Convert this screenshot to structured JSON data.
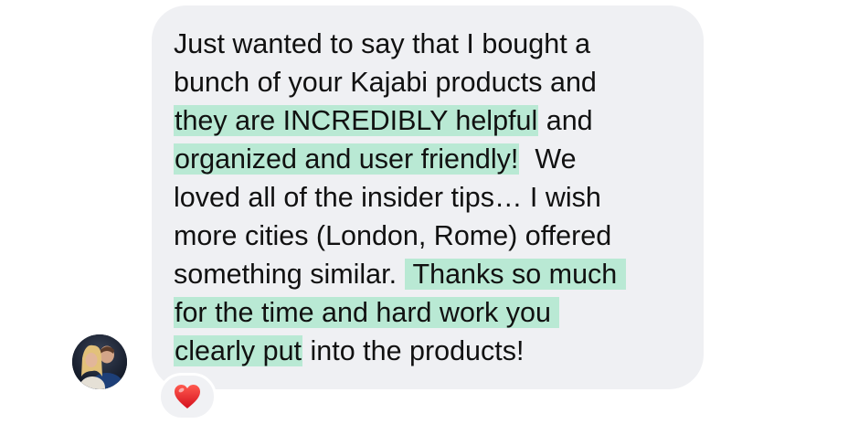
{
  "message": {
    "lines": [
      {
        "before": "Just wanted to say that I bought a",
        "highlight": "",
        "after": ""
      },
      {
        "before": "bunch of your Kajabi products and",
        "highlight": "",
        "after": ""
      },
      {
        "before": "",
        "highlight": "they are INCREDIBLY helpful",
        "after": " and"
      },
      {
        "before": "",
        "highlight": "organized and user friendly!",
        "after": "  We"
      },
      {
        "before": "loved all of the insider tips… I wish",
        "highlight": "",
        "after": ""
      },
      {
        "before": "more cities (London, Rome) offered",
        "highlight": "",
        "after": ""
      },
      {
        "before": "something similar. ",
        "highlight": " Thanks so much ",
        "after": ""
      },
      {
        "before": "",
        "highlight": "for the time and hard work you ",
        "after": ""
      },
      {
        "before": "",
        "highlight": "clearly put",
        "after": " into the products!"
      }
    ]
  },
  "reaction": {
    "emoji": "❤️",
    "icon": "heart-icon"
  },
  "avatar": {
    "icon": "profile-photo"
  },
  "colors": {
    "bubble": "#eff0f3",
    "highlight": "#b9e9d4",
    "text": "#111111"
  }
}
